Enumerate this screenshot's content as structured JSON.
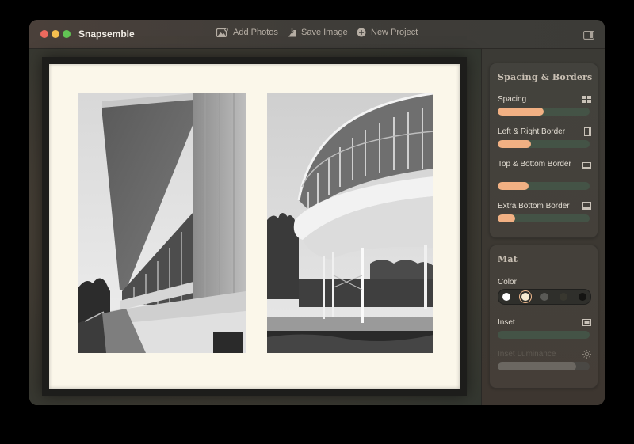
{
  "app": {
    "name": "Snapsemble"
  },
  "toolbar": {
    "add_photos": {
      "label": "Add Photos",
      "icon": "add-photos-icon"
    },
    "save_image": {
      "label": "Save Image",
      "icon": "save-image-icon"
    },
    "new_project": {
      "label": "New Project",
      "icon": "plus-circle-icon"
    },
    "sidebar_toggle_icon": "sidebar-toggle-icon"
  },
  "sidebar": {
    "spacing_borders": {
      "title": "Spacing & Borders",
      "controls": [
        {
          "label": "Spacing",
          "value": 0.5,
          "icon": "grid-icon"
        },
        {
          "label": "Left & Right Border",
          "value": 0.36,
          "icon": "side-border-icon"
        },
        {
          "label": "Top & Bottom Border",
          "value": 0.34,
          "icon": "top-bottom-border-icon"
        },
        {
          "label": "Extra Bottom Border",
          "value": 0.19,
          "icon": "bottom-border-icon"
        }
      ]
    },
    "mat": {
      "title": "Mat",
      "color_label": "Color",
      "colors": [
        "#ffffff",
        "#f6ead0",
        "#5a5a56",
        "#38372f",
        "#141412"
      ],
      "selected_color": 1,
      "inset_label": "Inset",
      "inset_value": 0.0,
      "inset_icon": "inset-icon",
      "luminance_label": "Inset Luminance",
      "luminance_value": 0.85,
      "luminance_icon": "sun-icon"
    }
  },
  "canvas": {
    "mat_color": "#fbf7ea",
    "photos": [
      {
        "description_icon": "photo-left-building"
      },
      {
        "description_icon": "photo-right-building"
      }
    ]
  },
  "colors": {
    "accent": "#f1b083",
    "track": "#445346"
  }
}
